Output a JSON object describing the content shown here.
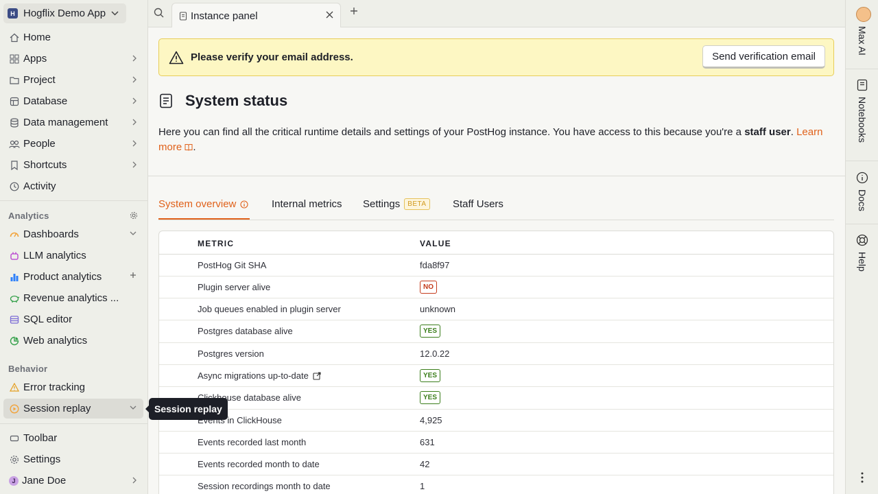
{
  "project": {
    "badge": "H",
    "name": "Hogflix Demo App"
  },
  "nav_top": [
    {
      "label": "Home"
    },
    {
      "label": "Apps"
    },
    {
      "label": "Project"
    },
    {
      "label": "Database"
    },
    {
      "label": "Data management"
    },
    {
      "label": "People"
    },
    {
      "label": "Shortcuts"
    },
    {
      "label": "Activity"
    }
  ],
  "analytics": {
    "label": "Analytics",
    "items": [
      {
        "label": "Dashboards"
      },
      {
        "label": "LLM analytics"
      },
      {
        "label": "Product analytics"
      },
      {
        "label": "Revenue analytics ..."
      },
      {
        "label": "SQL editor"
      },
      {
        "label": "Web analytics"
      }
    ]
  },
  "behavior": {
    "label": "Behavior",
    "items": [
      {
        "label": "Error tracking"
      },
      {
        "label": "Session replay"
      }
    ]
  },
  "nav_bottom": [
    {
      "label": "Toolbar"
    },
    {
      "label": "Settings"
    },
    {
      "label": "Jane Doe",
      "avatar": "J"
    }
  ],
  "tooltip": "Session replay",
  "topbar": {
    "tab_title": "Instance panel"
  },
  "right_rail": {
    "items": [
      "Max AI",
      "Notebooks",
      "Docs",
      "Help"
    ]
  },
  "banner": {
    "text": "Please verify your email address.",
    "button": "Send verification email"
  },
  "page": {
    "title": "System status",
    "desc_before": "Here you can find all the critical runtime details and settings of your PostHog instance. You have access to this because you're a ",
    "desc_bold": "staff user",
    "desc_mid": ". ",
    "desc_link": "Learn more",
    "desc_after": "."
  },
  "tabs": [
    {
      "label": "System overview"
    },
    {
      "label": "Internal metrics"
    },
    {
      "label": "Settings",
      "badge": "BETA"
    },
    {
      "label": "Staff Users"
    }
  ],
  "table": {
    "headers": {
      "metric": "METRIC",
      "value": "VALUE"
    },
    "rows": [
      {
        "metric": "PostHog Git SHA",
        "value": "fda8f97"
      },
      {
        "metric": "Plugin server alive",
        "value": "NO"
      },
      {
        "metric": "Job queues enabled in plugin server",
        "value": "unknown"
      },
      {
        "metric": "Postgres database alive",
        "value": "YES"
      },
      {
        "metric": "Postgres version",
        "value": "12.0.22"
      },
      {
        "metric": "Async migrations up-to-date",
        "value": "YES"
      },
      {
        "metric": "Clickhouse database alive",
        "value": "YES"
      },
      {
        "metric": "Events in ClickHouse",
        "value": "4,925"
      },
      {
        "metric": "Events recorded last month",
        "value": "631"
      },
      {
        "metric": "Events recorded month to date",
        "value": "42"
      },
      {
        "metric": "Session recordings month to date",
        "value": "1"
      }
    ]
  },
  "colors": {
    "accent": "#e0611a",
    "no": "#c43b1b",
    "yes": "#3a7d1a",
    "banner": "#fdf7c3"
  }
}
